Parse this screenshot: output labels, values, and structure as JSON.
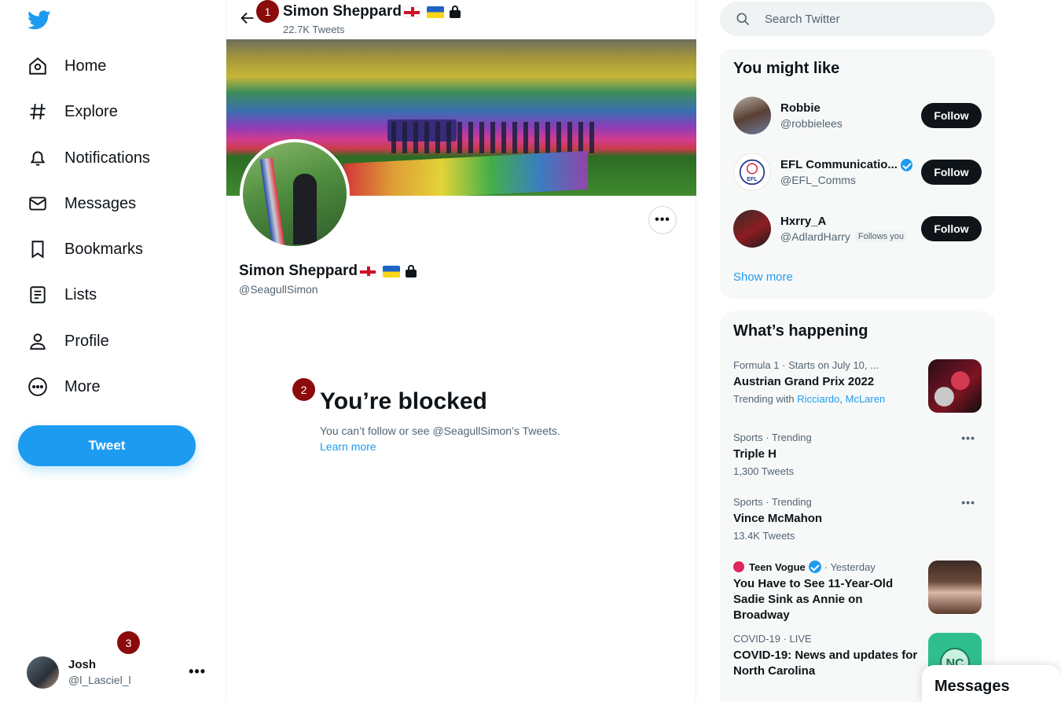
{
  "nav": {
    "items": [
      {
        "label": "Home",
        "icon": "home-icon"
      },
      {
        "label": "Explore",
        "icon": "hashtag-icon"
      },
      {
        "label": "Notifications",
        "icon": "bell-icon"
      },
      {
        "label": "Messages",
        "icon": "envelope-icon"
      },
      {
        "label": "Bookmarks",
        "icon": "bookmark-icon"
      },
      {
        "label": "Lists",
        "icon": "list-icon"
      },
      {
        "label": "Profile",
        "icon": "person-icon"
      },
      {
        "label": "More",
        "icon": "more-circle-icon"
      }
    ],
    "tweet_label": "Tweet",
    "account": {
      "name": "Josh",
      "handle": "@l_Lasciel_l",
      "menu": "•••"
    }
  },
  "profile": {
    "name": "Simon Sheppard",
    "tweet_count": "22.7K Tweets",
    "handle": "@SeagullSimon",
    "more_glyph": "•••",
    "blocked_title": "You’re blocked",
    "blocked_desc": "You can’t follow or see @SeagullSimon’s Tweets.",
    "learn_more": "Learn more"
  },
  "markers": [
    "1",
    "2",
    "3"
  ],
  "search": {
    "placeholder": "Search Twitter"
  },
  "you_might_like": {
    "title": "You might like",
    "users": [
      {
        "name": "Robbie",
        "handle": "@robbielees",
        "verified": false,
        "follows_you": "",
        "button": "Follow"
      },
      {
        "name": "EFL Communicatio...",
        "handle": "@EFL_Comms",
        "verified": true,
        "follows_you": "",
        "button": "Follow"
      },
      {
        "name": "Hxrry_A",
        "handle": "@AdlardHarry",
        "verified": false,
        "follows_you": "Follows you",
        "button": "Follow"
      }
    ],
    "show_more": "Show more"
  },
  "whats_happening": {
    "title": "What’s happening",
    "trends": [
      {
        "meta": "Formula 1 · Starts on July 10, ...",
        "title": "Austrian Grand Prix 2022",
        "sub_prefix": "Trending with",
        "links": [
          "Ricciardo",
          "McLaren"
        ]
      },
      {
        "meta": "Sports · Trending",
        "title": "Triple H",
        "sub": "1,300 Tweets"
      },
      {
        "meta": "Sports · Trending",
        "title": "Vince McMahon",
        "sub": "13.4K Tweets"
      },
      {
        "meta_source": "Teen Vogue",
        "meta_time": "· Yesterday",
        "title": "You Have to See 11-Year-Old Sadie Sink as Annie on Broadway"
      },
      {
        "meta": "COVID-19 · LIVE",
        "title": "COVID-19: News and updates for North Carolina"
      }
    ]
  },
  "messages_drawer": {
    "label": "Messages"
  },
  "colors": {
    "accent": "#1d9bf0",
    "text": "#0f1419",
    "muted": "#536471",
    "marker": "#8b0b0b"
  }
}
